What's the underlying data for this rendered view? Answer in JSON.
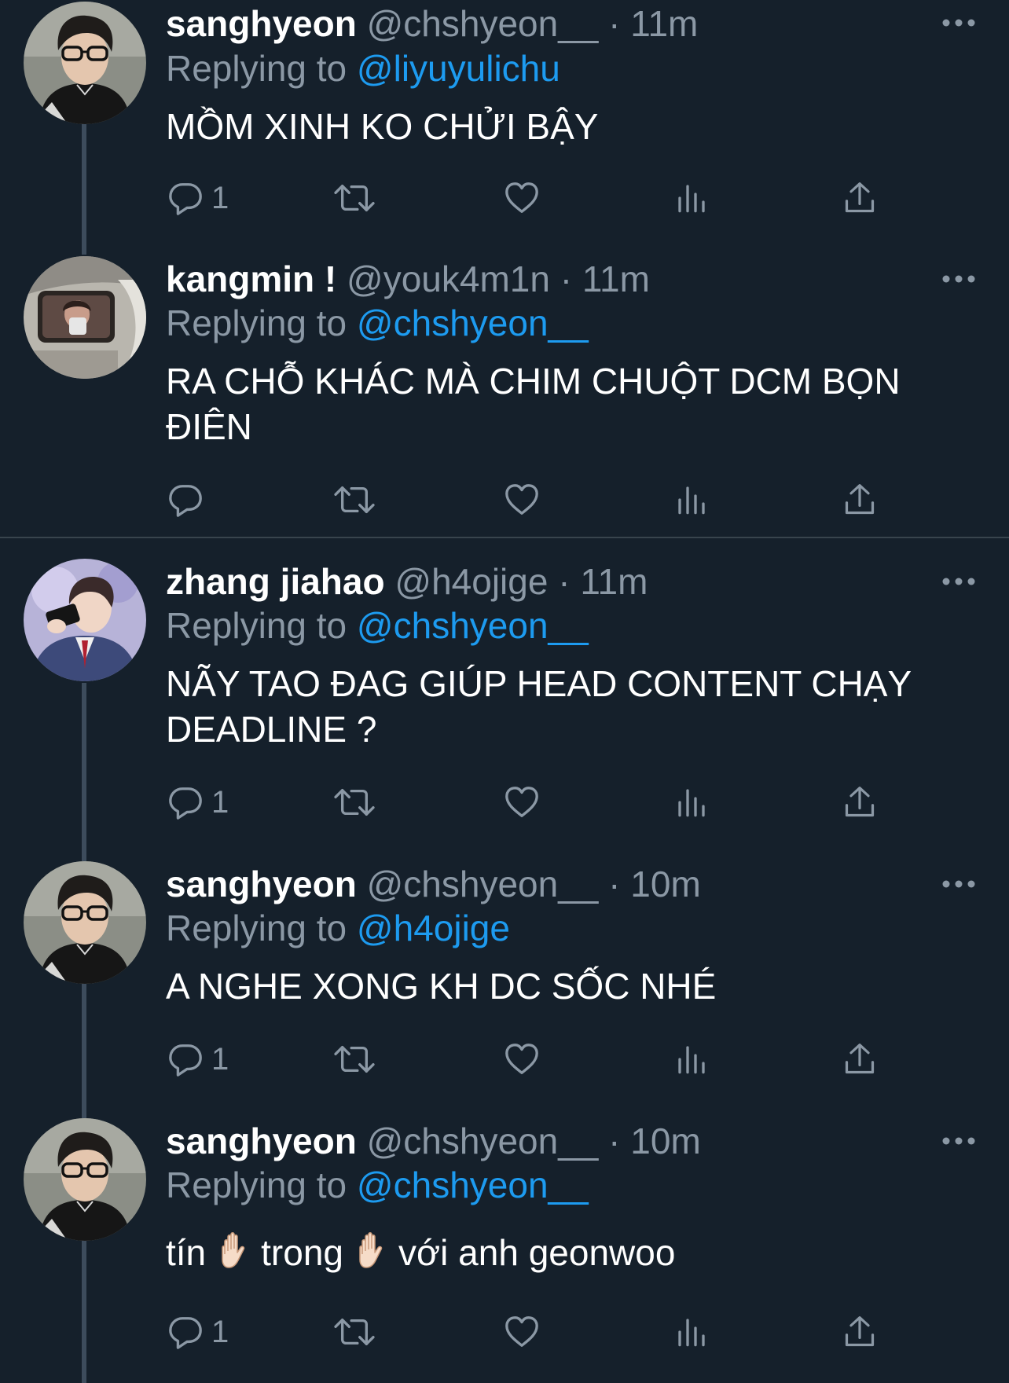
{
  "colors": {
    "background": "#15202b",
    "text": "#ffffff",
    "secondary": "#8b98a5",
    "link": "#1d9bf0",
    "thread_line": "#3d4c5c",
    "divider": "#38444d"
  },
  "tweets": [
    {
      "name": "sanghyeon",
      "handle": "@chshyeon__",
      "dot": "·",
      "time": "11m",
      "replying_prefix": "Replying to",
      "replying_to": "@liyuyulichu",
      "text": "MỒM XINH KO CHỬI BẬY",
      "reply_count": "1",
      "avatar": "sanghyeon-avatar"
    },
    {
      "name": "kangmin !",
      "handle": "@youk4m1n",
      "dot": "·",
      "time": "11m",
      "replying_prefix": "Replying to",
      "replying_to": "@chshyeon__",
      "text": "RA CHỖ KHÁC MÀ CHIM CHUỘT DCM BỌN ĐIÊN",
      "reply_count": "",
      "avatar": "kangmin-avatar"
    },
    {
      "name": "zhang jiahao",
      "handle": "@h4ojige",
      "dot": "·",
      "time": "11m",
      "replying_prefix": "Replying to",
      "replying_to": "@chshyeon__",
      "text": "NÃY TAO ĐAG GIÚP HEAD CONTENT CHẠY DEADLINE ?",
      "reply_count": "1",
      "avatar": "zhang-jiahao-avatar"
    },
    {
      "name": "sanghyeon",
      "handle": "@chshyeon__",
      "dot": "·",
      "time": "10m",
      "replying_prefix": "Replying to",
      "replying_to": "@h4ojige",
      "text": "A NGHE XONG KH DC SỐC NHÉ",
      "reply_count": "1",
      "avatar": "sanghyeon-avatar"
    },
    {
      "name": "sanghyeon",
      "handle": "@chshyeon__",
      "dot": "·",
      "time": "10m",
      "replying_prefix": "Replying to",
      "replying_to": "@chshyeon__",
      "text_parts": [
        "tín",
        "trong",
        "với anh geonwoo"
      ],
      "emoji": "raised-hand-emoji",
      "reply_count": "1",
      "avatar": "sanghyeon-avatar"
    }
  ],
  "icons": {
    "more": "more-icon",
    "reply": "reply-icon",
    "retweet": "retweet-icon",
    "like": "like-icon",
    "views": "views-icon",
    "share": "share-icon"
  }
}
